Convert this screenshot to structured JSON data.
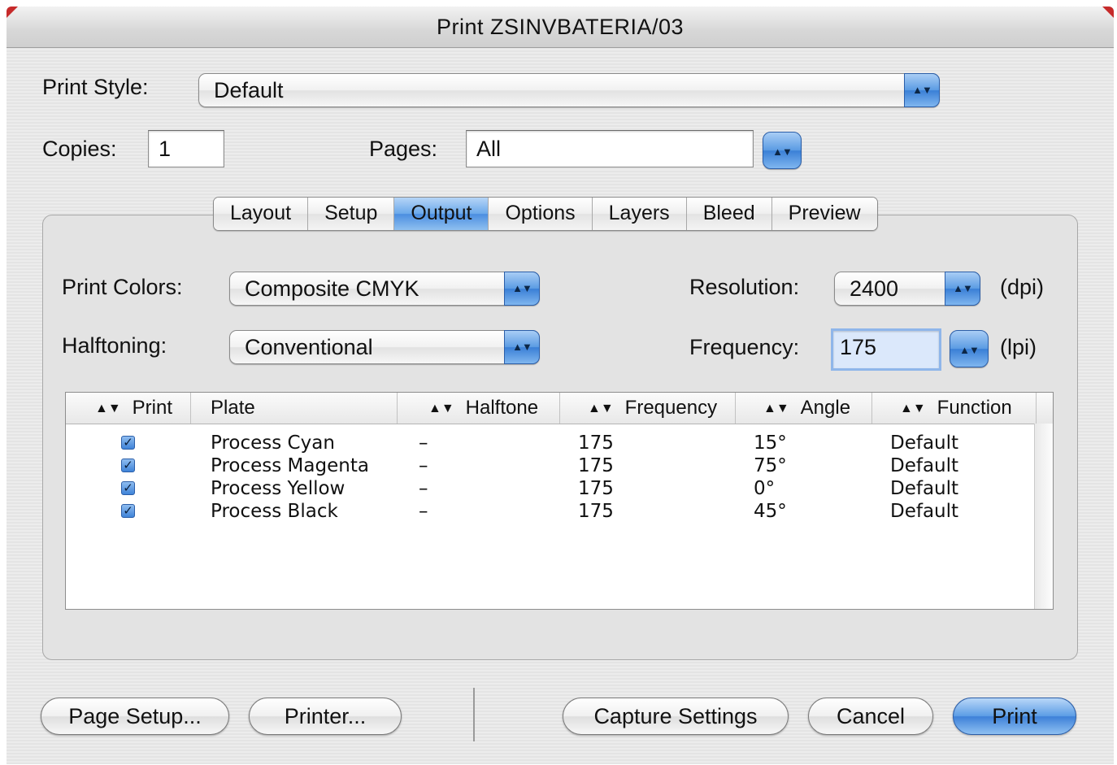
{
  "window": {
    "title": "Print ZSINVBATERIA/03"
  },
  "print_style": {
    "label": "Print Style:",
    "value": "Default"
  },
  "copies": {
    "label": "Copies:",
    "value": "1"
  },
  "pages": {
    "label": "Pages:",
    "value": "All"
  },
  "tabs": [
    {
      "label": "Layout",
      "active": false
    },
    {
      "label": "Setup",
      "active": false
    },
    {
      "label": "Output",
      "active": true
    },
    {
      "label": "Options",
      "active": false
    },
    {
      "label": "Layers",
      "active": false
    },
    {
      "label": "Bleed",
      "active": false
    },
    {
      "label": "Preview",
      "active": false
    }
  ],
  "output": {
    "print_colors": {
      "label": "Print Colors:",
      "value": "Composite CMYK"
    },
    "halftoning": {
      "label": "Halftoning:",
      "value": "Conventional"
    },
    "resolution": {
      "label": "Resolution:",
      "value": "2400",
      "unit": "(dpi)"
    },
    "frequency": {
      "label": "Frequency:",
      "value": "175",
      "unit": "(lpi)"
    }
  },
  "plates_table": {
    "columns": [
      "Print",
      "Plate",
      "Halftone",
      "Frequency",
      "Angle",
      "Function"
    ],
    "rows": [
      {
        "print": true,
        "plate": "Process Cyan",
        "halftone": "–",
        "frequency": "175",
        "angle": "15°",
        "function": "Default"
      },
      {
        "print": true,
        "plate": "Process Magenta",
        "halftone": "–",
        "frequency": "175",
        "angle": "75°",
        "function": "Default"
      },
      {
        "print": true,
        "plate": "Process Yellow",
        "halftone": "–",
        "frequency": "175",
        "angle": "0°",
        "function": "Default"
      },
      {
        "print": true,
        "plate": "Process Black",
        "halftone": "–",
        "frequency": "175",
        "angle": "45°",
        "function": "Default"
      }
    ]
  },
  "buttons": {
    "page_setup": "Page Setup...",
    "printer": "Printer...",
    "capture_settings": "Capture Settings",
    "cancel": "Cancel",
    "print": "Print"
  },
  "icons": {
    "popup_arrows": "updown-chevron-icon",
    "sort": "sort-icon",
    "checkbox": "checkmark-icon"
  }
}
